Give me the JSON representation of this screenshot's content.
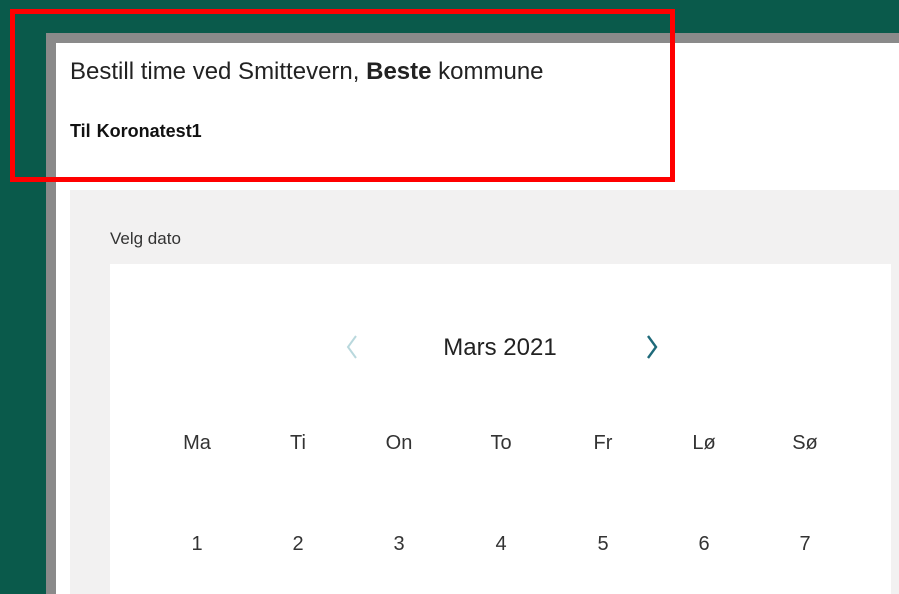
{
  "header": {
    "title_prefix": "Bestill time ved Smittevern,",
    "title_bold": "Beste",
    "title_suffix": "kommune",
    "subtitle_label": "Til",
    "subtitle_value": "Koronatest1"
  },
  "form": {
    "date_label": "Velg dato"
  },
  "calendar": {
    "month": "Mars 2021",
    "prev_icon": "chevron-left-icon",
    "next_icon": "chevron-right-icon",
    "weekdays": [
      "Ma",
      "Ti",
      "On",
      "To",
      "Fr",
      "Lø",
      "Sø"
    ],
    "days": [
      "1",
      "2",
      "3",
      "4",
      "5",
      "6",
      "7"
    ]
  },
  "colors": {
    "background": "#0a5a4b",
    "highlight": "#ff0000",
    "nav_disabled": "#b9d8dd",
    "nav_active": "#1f6a7a"
  }
}
